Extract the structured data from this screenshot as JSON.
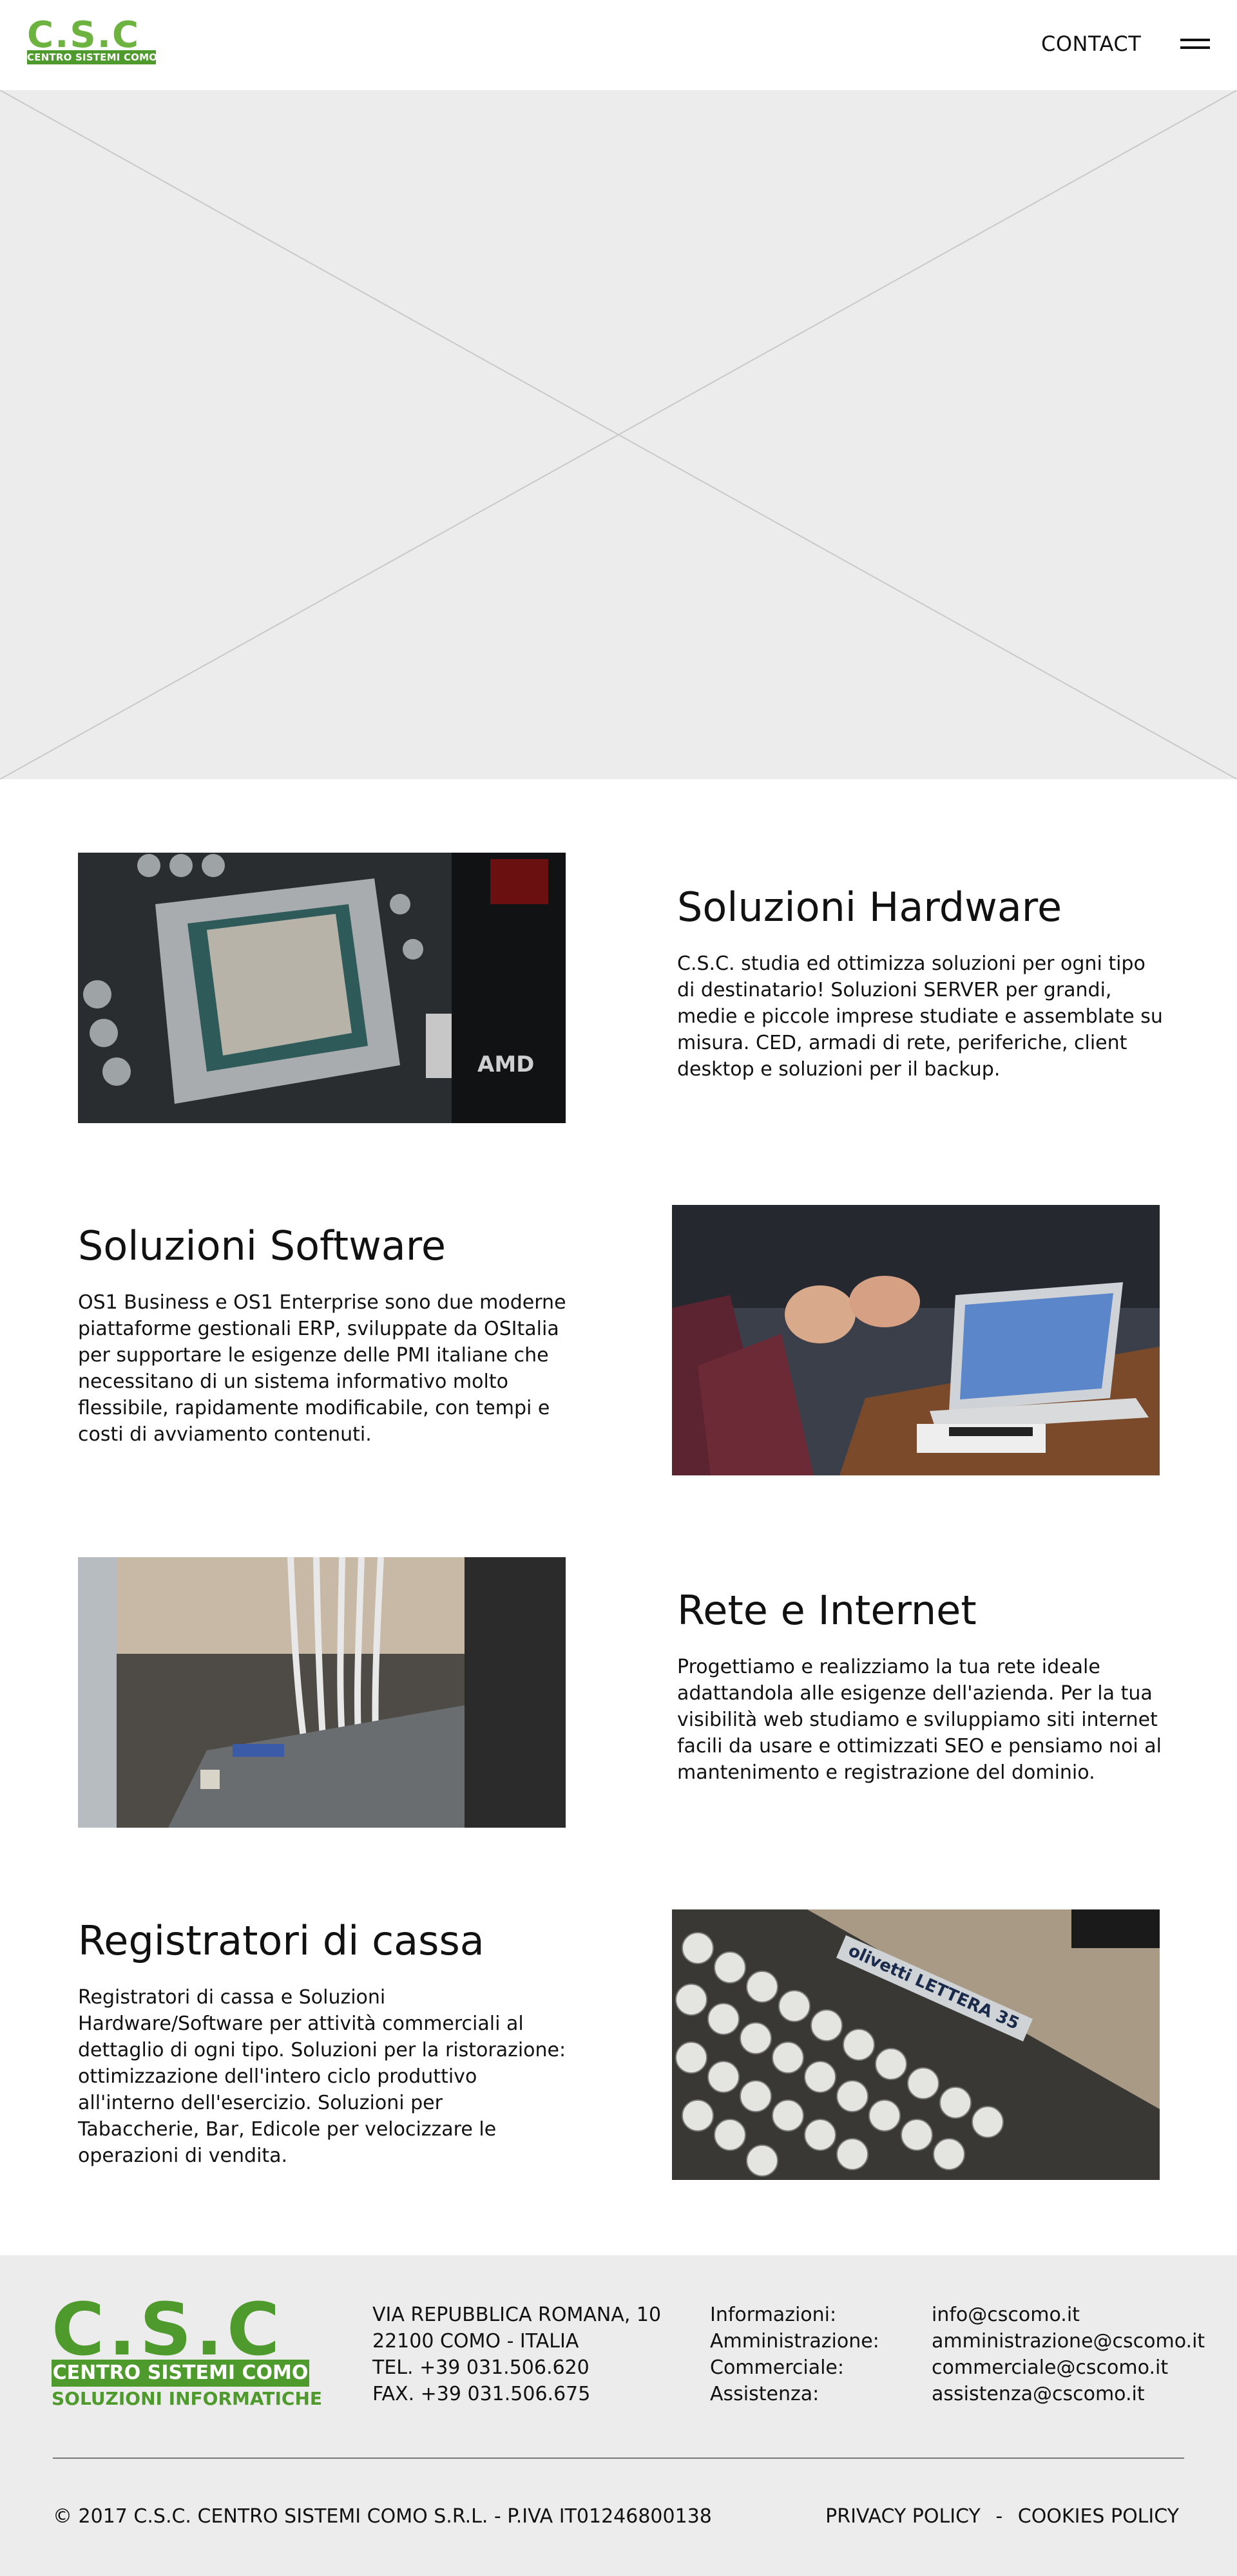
{
  "header": {
    "logo_letters": "C.S.C",
    "logo_bar": "CENTRO SISTEMI COMO",
    "contact_label": "CONTACT",
    "menu_icon": "hamburger-icon"
  },
  "hero": {
    "type": "image-placeholder"
  },
  "sections": [
    {
      "title": "Soluzioni Hardware",
      "text": "C.S.C. studia ed ottimizza soluzioni per ogni tipo di destinatario! Soluzioni SERVER per grandi, medie e piccole imprese studiate e assemblate su misura. CED, armadi di rete, periferiche, client desktop e soluzioni per il backup.",
      "image": "cpu-motherboard-photo"
    },
    {
      "title": "Soluzioni Software",
      "text": "OS1 Business e OS1 Enterprise sono due moderne piattaforme gestionali ERP, sviluppate da OSItalia per supportare le esigenze delle PMI italiane che necessitano di un sistema informativo molto flessibile, rapidamente modificabile, con tempi e costi di avviamento contenuti.",
      "image": "laptop-meeting-photo"
    },
    {
      "title": "Rete e Internet",
      "text": "Progettiamo e realizziamo la tua rete ideale adattandola alle esigenze dell'azienda. Per la tua visibilità web studiamo e sviluppiamo siti internet facili da usare e ottimizzati SEO e pensiamo noi al mantenimento e registrazione del dominio.",
      "image": "network-switch-cables-photo"
    },
    {
      "title": "Registratori di cassa",
      "text": "Registratori di cassa e Soluzioni Hardware/Software per attività commerciali al dettaglio di ogni tipo. Soluzioni per la ristorazione: ottimizzazione dell'intero ciclo produttivo all'interno dell'esercizio. Soluzioni per Tabaccherie, Bar, Edicole per velocizzare le operazioni di vendita.",
      "image": "typewriter-keys-photo",
      "image_text": "olivetti LETTERA 35"
    }
  ],
  "footer": {
    "logo_letters": "C.S.C",
    "logo_bar": "CENTRO SISTEMI COMO",
    "logo_sub": "SOLUZIONI INFORMATICHE",
    "address_lines": [
      "VIA REPUBBLICA ROMANA, 10",
      "22100 COMO - ITALIA",
      "TEL. +39 031.506.620",
      "FAX. +39 031.506.675"
    ],
    "contacts": [
      {
        "label": "Informazioni:",
        "value": "info@cscomo.it"
      },
      {
        "label": "Amministrazione:",
        "value": "amministrazione@cscomo.it"
      },
      {
        "label": "Commerciale:",
        "value": "commerciale@cscomo.it"
      },
      {
        "label": "Assistenza:",
        "value": "assistenza@cscomo.it"
      }
    ],
    "copyright": "© 2017 C.S.C. CENTRO SISTEMI COMO S.R.L. - P.IVA IT01246800138",
    "privacy_label": "PRIVACY POLICY",
    "separator": "-",
    "cookies_label": "COOKIES POLICY"
  },
  "colors": {
    "brand_green": "#4f9a2c",
    "brand_green_light": "#6cb33f",
    "hero_bg": "#ececec",
    "footer_bg": "#ececec"
  }
}
